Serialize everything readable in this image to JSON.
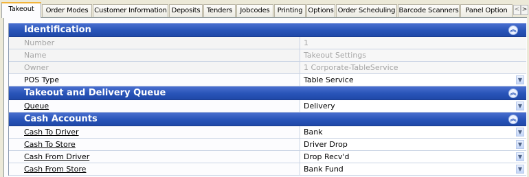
{
  "tabs": [
    {
      "label": "Takeout",
      "active": true
    },
    {
      "label": "Order Modes"
    },
    {
      "label": "Customer Information"
    },
    {
      "label": "Deposits"
    },
    {
      "label": "Tenders"
    },
    {
      "label": "Jobcodes"
    },
    {
      "label": "Printing"
    },
    {
      "label": "Options"
    },
    {
      "label": "Order Scheduling"
    },
    {
      "label": "Barcode Scanners"
    },
    {
      "label": "Panel Option"
    }
  ],
  "scroll": {
    "left": "<",
    "right": ">"
  },
  "sections": [
    {
      "title": "Identification",
      "rows": [
        {
          "label": "Number",
          "value": "1",
          "disabled": true
        },
        {
          "label": "Name",
          "value": "Takeout Settings",
          "disabled": true
        },
        {
          "label": "Owner",
          "value": "1  Corporate-TableService",
          "disabled": true
        },
        {
          "label": "POS Type",
          "value": "Table Service",
          "dropdown": true
        }
      ]
    },
    {
      "title": "Takeout and Delivery Queue",
      "rows": [
        {
          "label": "Queue",
          "value": "Delivery",
          "dropdown": true,
          "link": true
        }
      ]
    },
    {
      "title": "Cash Accounts",
      "rows": [
        {
          "label": "Cash To Driver",
          "value": "Bank",
          "dropdown": true,
          "link": true
        },
        {
          "label": "Cash To Store",
          "value": "Driver Drop",
          "dropdown": true,
          "link": true
        },
        {
          "label": "Cash From Driver",
          "value": "Drop Recv'd",
          "dropdown": true,
          "link": true
        },
        {
          "label": "Cash From Store",
          "value": "Bank Fund",
          "dropdown": true,
          "link": true
        }
      ]
    }
  ],
  "icons": {
    "collapse": "double-chevron-up-icon",
    "dropdown": "chevron-down-icon"
  }
}
